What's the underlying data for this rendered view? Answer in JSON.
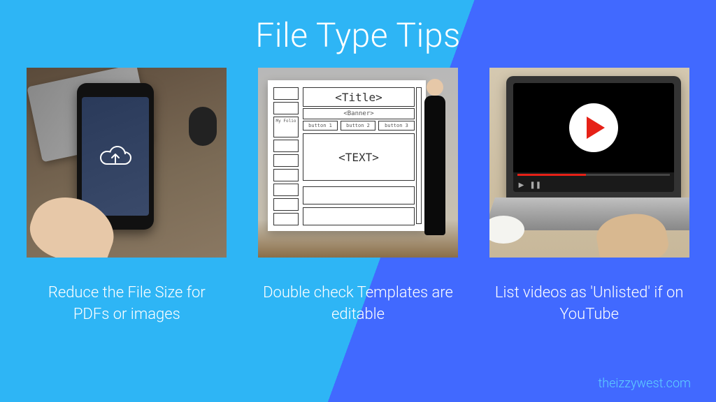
{
  "title": "File Type Tips",
  "attribution": "theizzywest.com",
  "cards": [
    {
      "icon": "cloud-upload-icon",
      "caption": "Reduce the File Size for PDFs or images"
    },
    {
      "icon": "template-wireframe-icon",
      "caption": "Double check Templates are editable",
      "wireframe": {
        "title": "<Title>",
        "banner": "<Banner>",
        "text": "<TEXT>",
        "button1": "button 1",
        "button2": "button 2",
        "button3": "button 3",
        "profile": "My Folio"
      }
    },
    {
      "icon": "video-play-icon",
      "caption": "List videos as 'Unlisted' if on YouTube"
    }
  ]
}
